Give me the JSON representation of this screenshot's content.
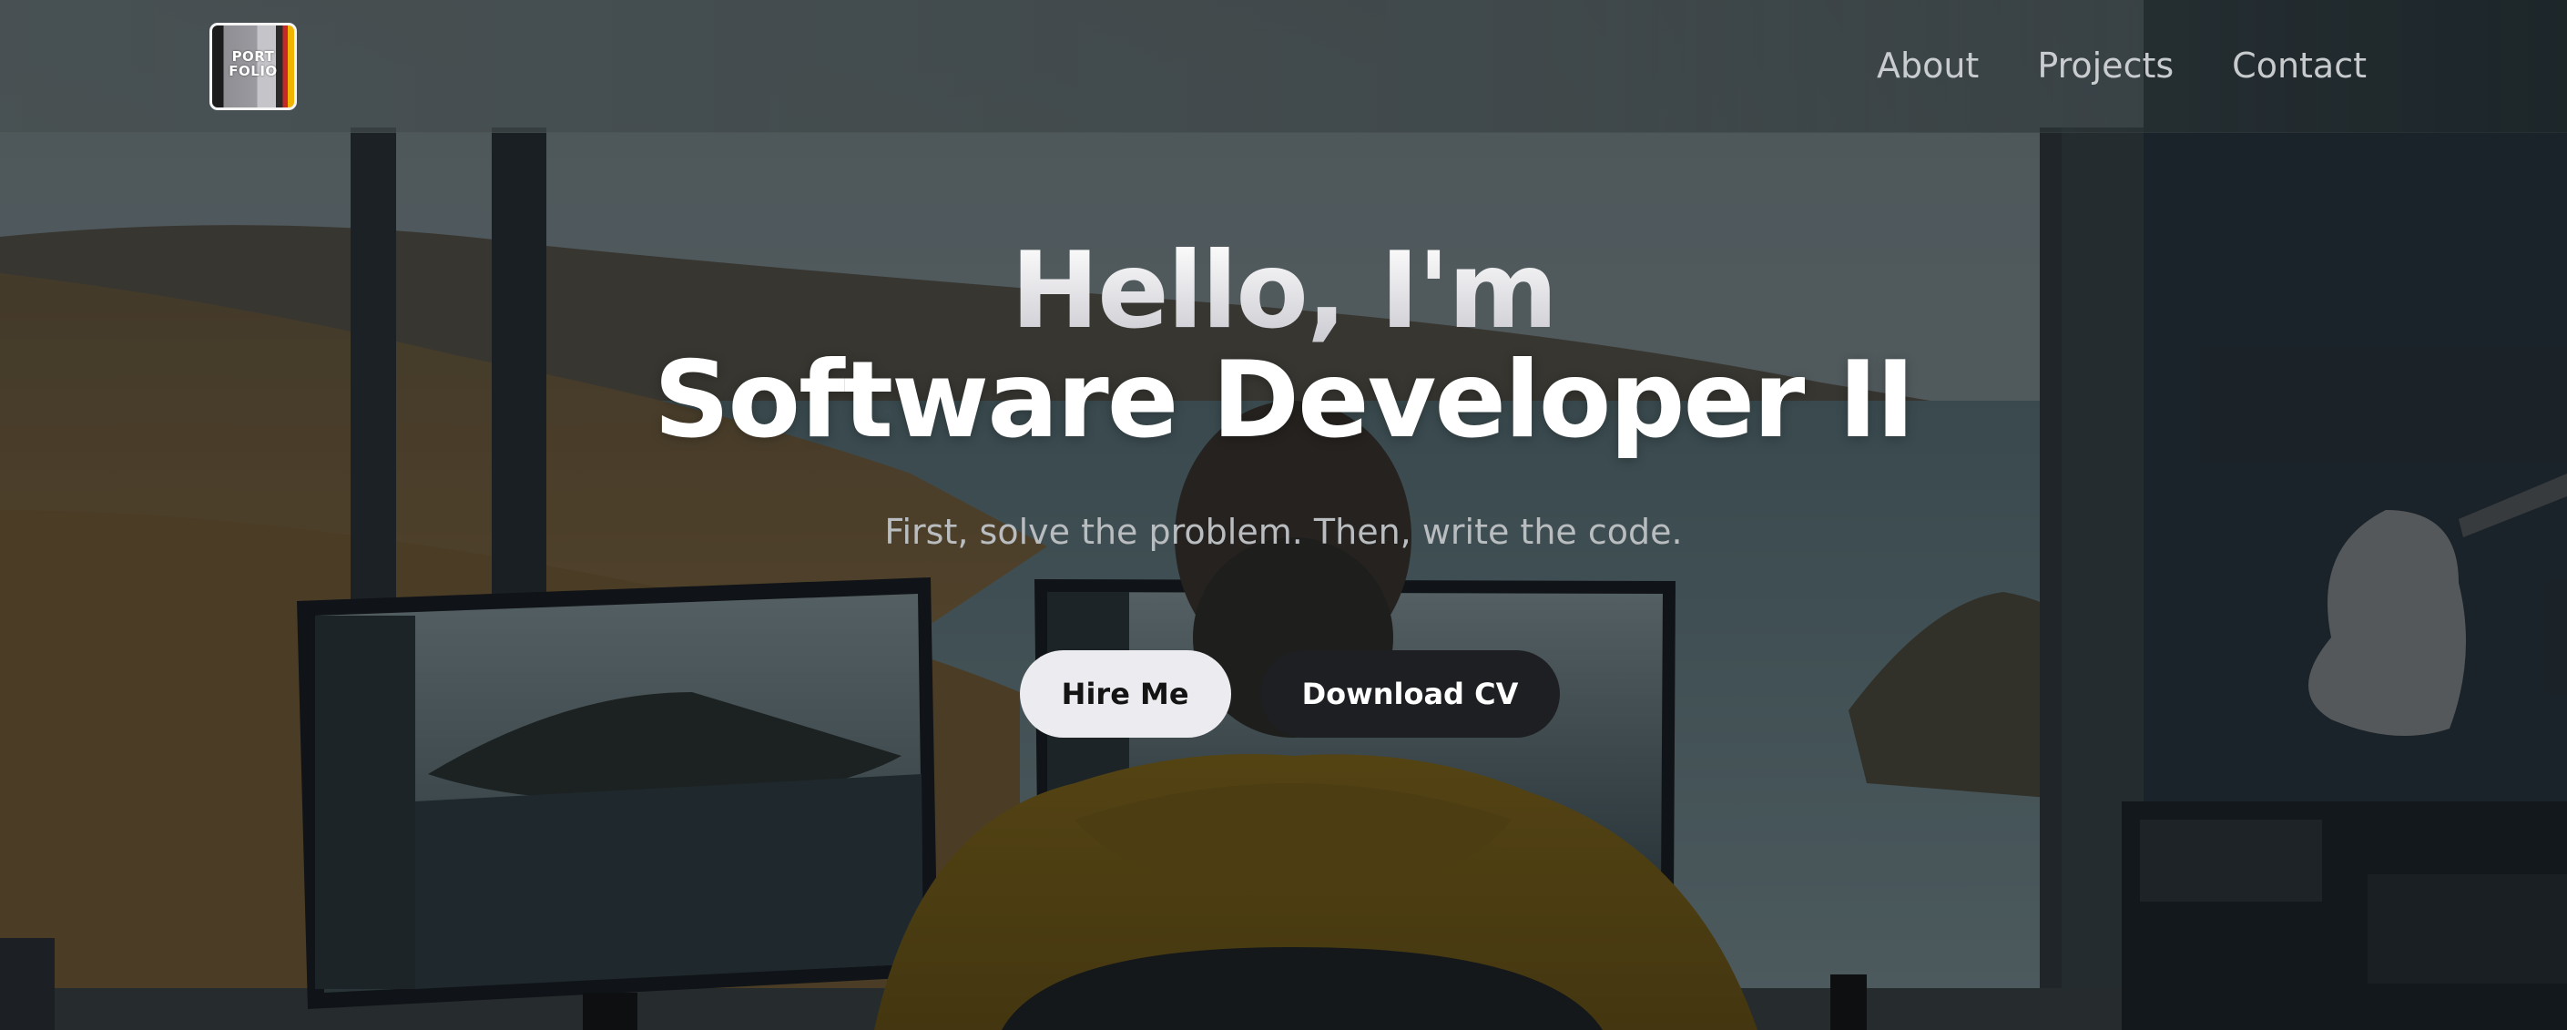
{
  "header": {
    "logo": {
      "line1": "PORT",
      "line2": "FOLIO"
    },
    "nav": [
      {
        "label": "About"
      },
      {
        "label": "Projects"
      },
      {
        "label": "Contact"
      }
    ]
  },
  "hero": {
    "greeting": "Hello, I'm",
    "title": "Software Developer II",
    "tagline": "First, solve the problem. Then, write the code.",
    "buttons": {
      "primary_label": "Hire Me",
      "secondary_label": "Download CV"
    }
  },
  "colors": {
    "primary_button_bg": "#ecebef",
    "secondary_button_bg": "#1d1f22",
    "nav_text": "#d6d9db",
    "tagline_text": "#b9bdc0"
  },
  "icons": [
    "portfolio-logo-icon"
  ]
}
